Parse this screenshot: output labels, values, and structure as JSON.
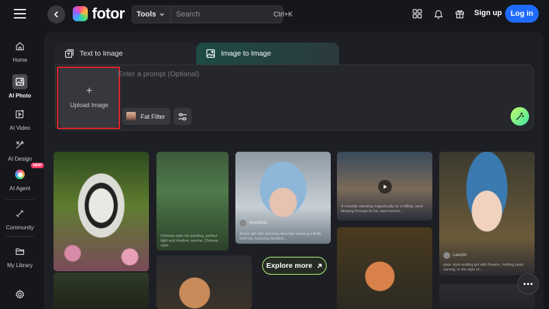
{
  "app": {
    "brand": "fotor"
  },
  "header": {
    "tools_label": "Tools",
    "search_placeholder": "Search",
    "search_shortcut": "Ctrl+K",
    "signup_label": "Sign up",
    "login_label": "Log in"
  },
  "sidebar": {
    "items": [
      {
        "label": "Home",
        "icon": "home-icon"
      },
      {
        "label": "AI Photo",
        "icon": "image-icon",
        "active": true
      },
      {
        "label": "AI Video",
        "icon": "video-icon"
      },
      {
        "label": "AI Design",
        "icon": "design-icon"
      },
      {
        "label": "AI Agent",
        "icon": "agent-icon",
        "badge": "NEW"
      },
      {
        "label": "Community",
        "icon": "community-icon"
      },
      {
        "label": "My Library",
        "icon": "folder-icon"
      }
    ]
  },
  "generator": {
    "tabs": [
      {
        "label": "Text to Image",
        "active": false
      },
      {
        "label": "Image to Image",
        "active": true
      }
    ],
    "upload_label": "Upload Image",
    "prompt_placeholder": "Enter a prompt (Optional)",
    "filter_label": "Fat Filter"
  },
  "gallery": {
    "cards": [
      {
        "caption": "",
        "author": ""
      },
      {
        "caption": "Chinese-style ink painting, perfect light and shadow, serene, Chinese style...",
        "author": ""
      },
      {
        "caption": "Anime girl with stunning blue hair wearing a fluffy wolf hat, featuring detailed...",
        "author": "Amphibite"
      },
      {
        "caption": "A cheetah standing majestically on a hilltop, wind blowing through its fur, vast horizon...",
        "author": ""
      },
      {
        "caption": "pixar style smiling girl with flowers, holding pearl earring, in the style of...",
        "author": "Leechh"
      }
    ],
    "explore_label": "Explore more"
  },
  "colors": {
    "accent": "#1f6bff",
    "highlight": "#e0252b",
    "explore_border": "#b6ff7a"
  }
}
